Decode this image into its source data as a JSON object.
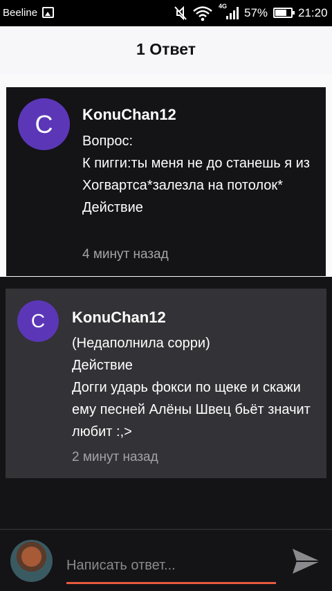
{
  "status_bar": {
    "carrier": "Beeline",
    "network": "4G",
    "battery": "57%",
    "time": "21:20"
  },
  "header": {
    "title": "1 Ответ"
  },
  "comments": [
    {
      "avatar_letter": "C",
      "username": "KonuChan12",
      "lines": [
        "Вопрос:",
        "К пигги:ты меня не до станешь я из Хогвартса*залезла на потолок*",
        "Действие"
      ],
      "time": "4 минут назад"
    },
    {
      "avatar_letter": "C",
      "username": "KonuChan12",
      "lines": [
        "(Недаполнила сорри)",
        "Действие",
        "Догги ударь фокси по щеке и скажи ему песней Алёны Швец бьёт значит любит :,>"
      ],
      "time": "2 минут назад"
    }
  ],
  "reply": {
    "placeholder": "Написать ответ..."
  },
  "colors": {
    "accent": "#e85a3e",
    "avatar": "#5b37b8",
    "card_dark": "#141316",
    "card_grey": "#333236"
  },
  "icons": [
    "image-icon",
    "mute-icon",
    "wifi-icon",
    "signal-icon",
    "battery-icon",
    "send-icon"
  ]
}
